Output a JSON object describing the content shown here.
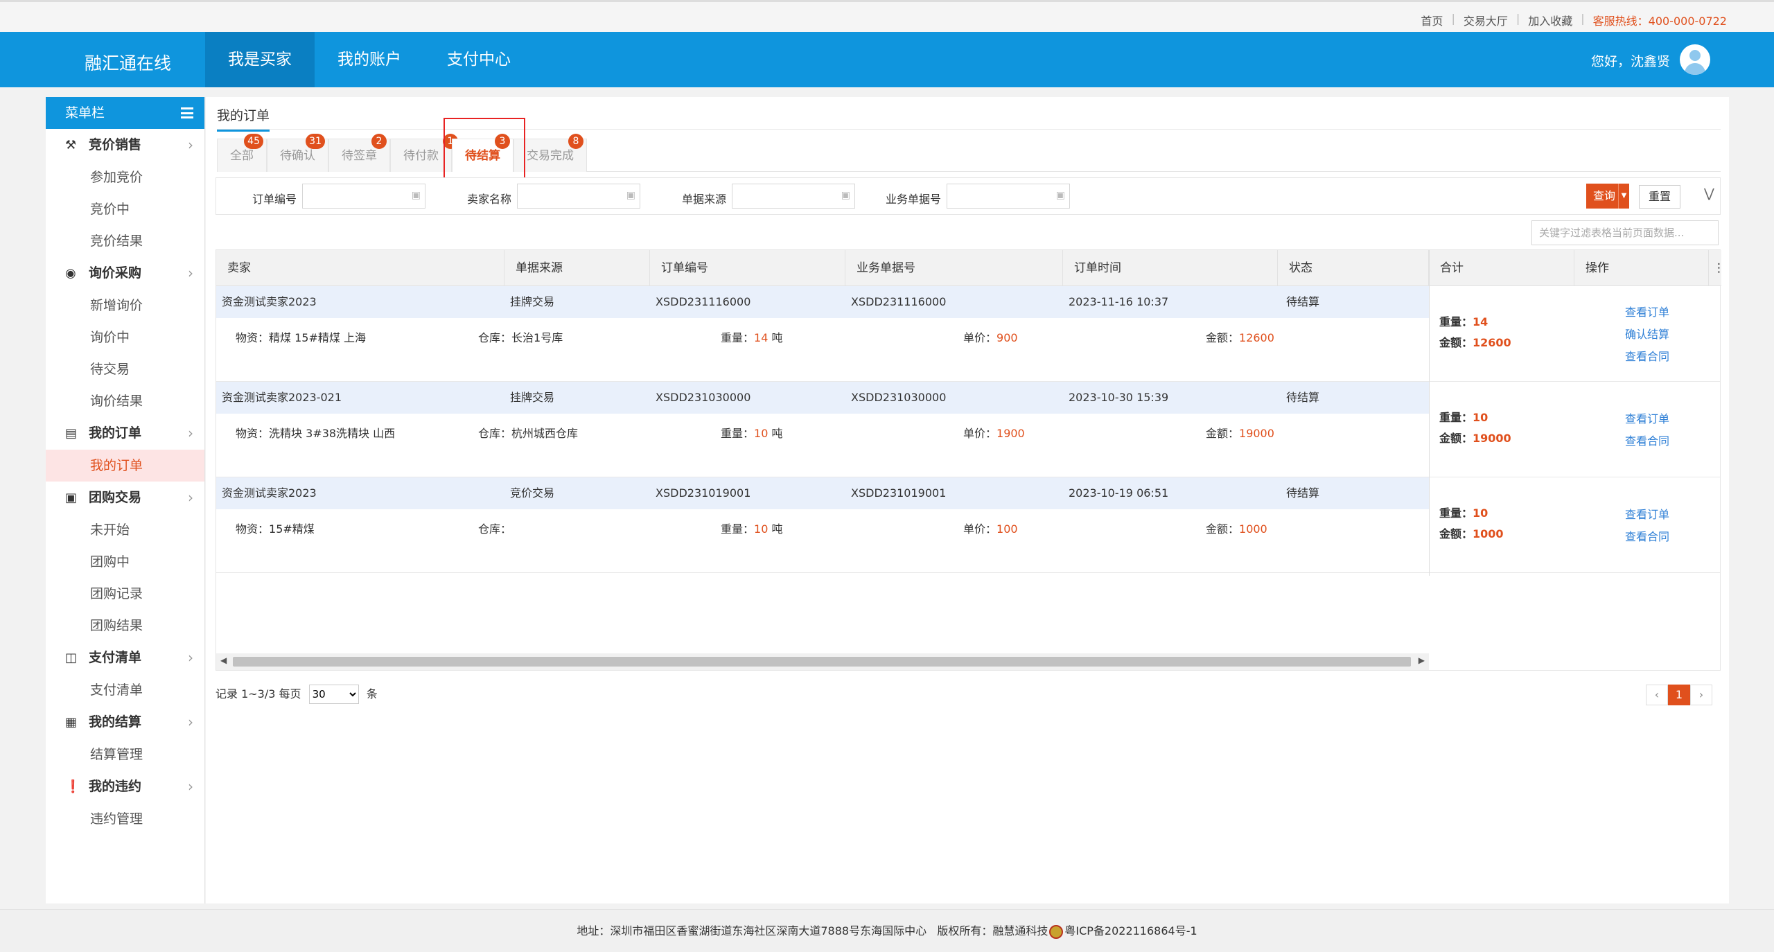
{
  "topbar": {
    "links": [
      "首页",
      "交易大厅",
      "加入收藏"
    ],
    "hotline": "客服热线：400-000-0722"
  },
  "header": {
    "brand": "融汇通在线",
    "nav": [
      "我是买家",
      "我的账户",
      "支付中心"
    ],
    "greeting": "您好，沈鑫贤"
  },
  "sidebar": {
    "title": "菜单栏",
    "groups": [
      {
        "label": "竞价销售",
        "icon": "gavel-icon",
        "items": [
          "参加竞价",
          "竞价中",
          "竞价结果"
        ]
      },
      {
        "label": "询价采购",
        "icon": "search-icon",
        "items": [
          "新增询价",
          "询价中",
          "待交易",
          "询价结果"
        ]
      },
      {
        "label": "我的订单",
        "icon": "document-icon",
        "items": [
          "我的订单"
        ]
      },
      {
        "label": "团购交易",
        "icon": "briefcase-icon",
        "items": [
          "未开始",
          "团购中",
          "团购记录",
          "团购结果"
        ]
      },
      {
        "label": "支付清单",
        "icon": "wallet-icon",
        "items": [
          "支付清单"
        ]
      },
      {
        "label": "我的结算",
        "icon": "calculator-icon",
        "items": [
          "结算管理"
        ]
      },
      {
        "label": "我的违约",
        "icon": "exclamation-icon",
        "items": [
          "违约管理"
        ]
      }
    ]
  },
  "content": {
    "title": "我的订单",
    "tabs": [
      {
        "label": "全部",
        "count": "45"
      },
      {
        "label": "待确认",
        "count": "31"
      },
      {
        "label": "待签章",
        "count": "2"
      },
      {
        "label": "待付款",
        "count": "1"
      },
      {
        "label": "待结算",
        "count": "3"
      },
      {
        "label": "交易完成",
        "count": "8"
      }
    ],
    "filters": {
      "order_no": "订单编号",
      "seller": "卖家名称",
      "source": "单据来源",
      "biz_no": "业务单据号"
    },
    "query_label": "查询",
    "reset_label": "重置",
    "keyword_placeholder": "关键字过滤表格当前页面数据...",
    "columns": [
      "卖家",
      "单据来源",
      "订单编号",
      "业务单据号",
      "订单时间",
      "状态",
      "合计",
      "操作"
    ],
    "labels": {
      "material": "物资：",
      "warehouse": "仓库：",
      "weight": "重量：",
      "unit_price": "单价：",
      "amount": "金额：",
      "ton": "吨"
    },
    "orders": [
      {
        "seller": "资金测试卖家2023",
        "source": "挂牌交易",
        "order_no": "XSDD231116000",
        "biz_no": "XSDD231116000",
        "time": "2023-11-16 10:37",
        "status": "待结算",
        "material": "精煤 15#精煤 上海",
        "warehouse": "长治1号库",
        "weight": "14",
        "price": "900",
        "amount": "12600",
        "sum_weight": "14",
        "sum_amount": "12600",
        "ops": [
          "查看订单",
          "确认结算",
          "查看合同"
        ]
      },
      {
        "seller": "资金测试卖家2023-021",
        "source": "挂牌交易",
        "order_no": "XSDD231030000",
        "biz_no": "XSDD231030000",
        "time": "2023-10-30 15:39",
        "status": "待结算",
        "material": "洗精块 3#38洗精块 山西",
        "warehouse": "杭州城西仓库",
        "weight": "10",
        "price": "1900",
        "amount": "19000",
        "sum_weight": "10",
        "sum_amount": "19000",
        "ops": [
          "查看订单",
          "查看合同"
        ]
      },
      {
        "seller": "资金测试卖家2023",
        "source": "竞价交易",
        "order_no": "XSDD231019001",
        "biz_no": "XSDD231019001",
        "time": "2023-10-19 06:51",
        "status": "待结算",
        "material": "15#精煤",
        "warehouse": "",
        "weight": "10",
        "price": "100",
        "amount": "1000",
        "sum_weight": "10",
        "sum_amount": "1000",
        "ops": [
          "查看订单",
          "查看合同"
        ]
      }
    ],
    "sum_weight_label": "重量：",
    "sum_amount_label": "金额：",
    "pager": {
      "record_text": "记录 1~3/3 每页",
      "page_size": "30",
      "unit": "条",
      "current_page": "1"
    }
  },
  "footer": {
    "address": "地址：深圳市福田区香蜜湖街道东海社区深南大道7888号东海国际中心",
    "copyright": "版权所有：融慧通科技",
    "icp": "粤ICP备2022116864号-1"
  },
  "colors": {
    "primary": "#0f95dd",
    "accent": "#e0501d",
    "link": "#2e7fd6"
  }
}
